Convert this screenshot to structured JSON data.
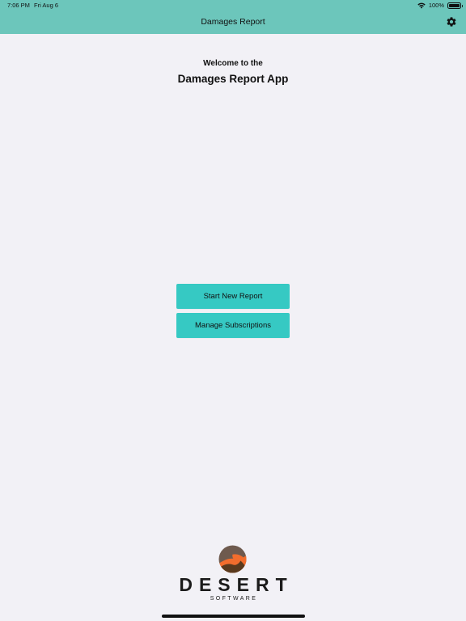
{
  "status_bar": {
    "time": "7:06 PM",
    "date": "Fri Aug 6",
    "battery_percent": "100%",
    "battery_level": 1.0
  },
  "navigation": {
    "title": "Damages Report",
    "settings_icon": "gear-icon"
  },
  "welcome": {
    "subtitle": "Welcome to the",
    "title": "Damages Report App"
  },
  "actions": {
    "start_new_report": "Start New Report",
    "manage_subscriptions": "Manage Subscriptions"
  },
  "brand": {
    "name": "DESERT",
    "tagline": "SOFTWARE",
    "logo_icon": "desert-sun-logo"
  },
  "colors": {
    "header": "#6cc6bb",
    "button": "#36c9c3",
    "background": "#f2f1f6",
    "logo_brown": "#6e5a4e",
    "logo_orange": "#f26d2d",
    "logo_dark": "#5a3a1e"
  }
}
